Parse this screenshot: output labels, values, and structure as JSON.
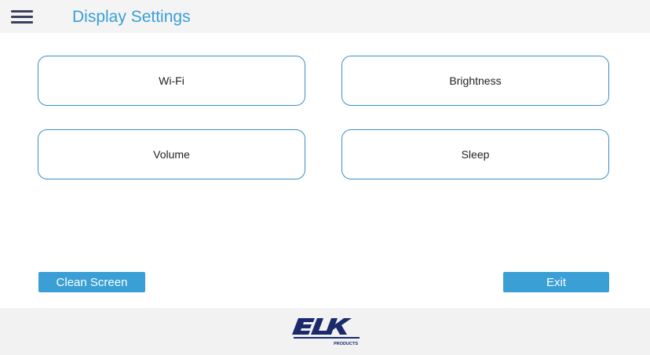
{
  "header": {
    "title": "Display Settings",
    "menu_icon": "hamburger-menu-icon"
  },
  "tiles": [
    {
      "label": "Wi-Fi"
    },
    {
      "label": "Brightness"
    },
    {
      "label": "Volume"
    },
    {
      "label": "Sleep"
    }
  ],
  "actions": {
    "clean_screen_label": "Clean Screen",
    "exit_label": "Exit"
  },
  "footer": {
    "logo_text": "ELK",
    "logo_subtext": "PRODUCTS"
  },
  "colors": {
    "accent": "#3a9fd5",
    "tile_border": "#3a8fc8",
    "header_bg": "#f4f4f4",
    "footer_bg": "#f2f2f2",
    "logo": "#1b2a6b"
  }
}
